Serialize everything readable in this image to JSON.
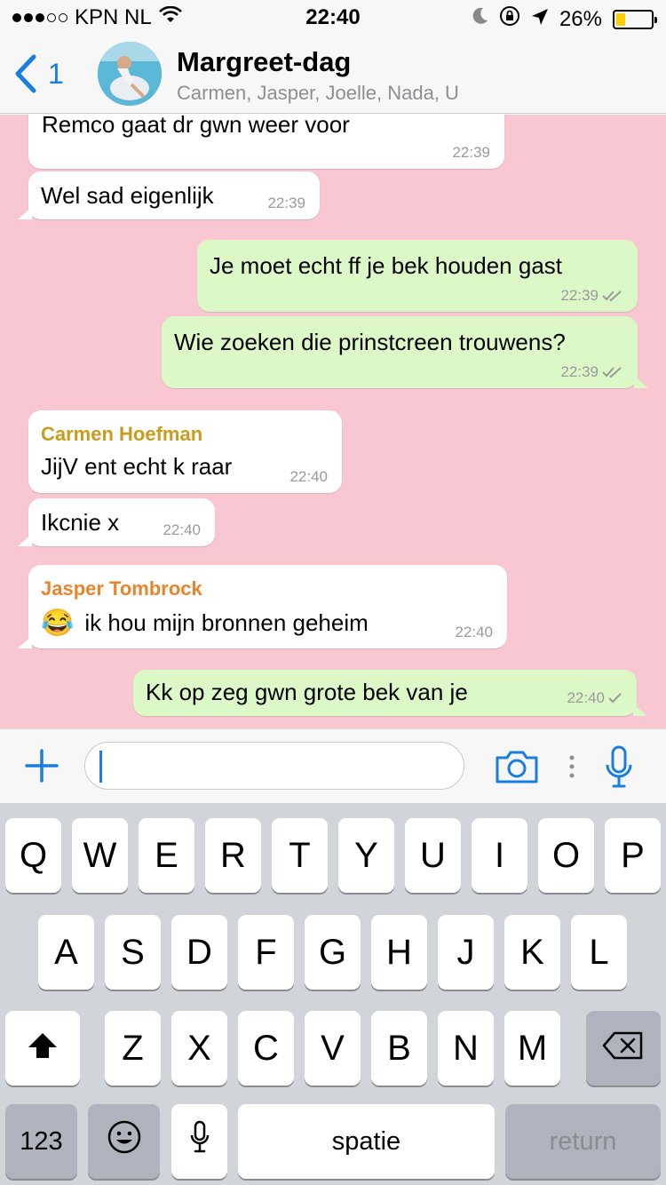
{
  "status_bar": {
    "carrier": "KPN NL",
    "time": "22:40",
    "battery_percent": "26%",
    "battery_level": 0.26,
    "battery_color": "#ffcc00",
    "signal_bars_filled": 3,
    "signal_bars_total": 5
  },
  "header": {
    "back_count": "1",
    "title": "Margreet-dag",
    "subtitle": "Carmen, Jasper, Joelle, Nada, U"
  },
  "messages": [
    {
      "direction": "in",
      "text": "Remco gaat dr gwn weer voor",
      "time": "22:39"
    },
    {
      "direction": "in",
      "text": "Wel sad eigenlijk",
      "time": "22:39"
    },
    {
      "direction": "out",
      "text": "Je moet echt ff je bek houden gast",
      "time": "22:39",
      "status": "read"
    },
    {
      "direction": "out",
      "text": "Wie zoeken die prinstcreen trouwens?",
      "time": "22:39",
      "status": "read"
    },
    {
      "direction": "in",
      "sender": "Carmen Hoefman",
      "sender_color": "#c99c1c",
      "text": "JijV ent echt k raar",
      "time": "22:40"
    },
    {
      "direction": "in",
      "text": "Ikcnie x",
      "time": "22:40"
    },
    {
      "direction": "in",
      "sender": "Jasper Tombrock",
      "sender_color": "#e8842c",
      "emoji": "😂",
      "text": "ik hou mijn bronnen geheim",
      "time": "22:40"
    },
    {
      "direction": "out",
      "text": "Kk op zeg gwn grote bek van je",
      "time": "22:40",
      "status": "sent"
    }
  ],
  "input": {
    "value": ""
  },
  "keyboard": {
    "row1": [
      "Q",
      "W",
      "E",
      "R",
      "T",
      "Y",
      "U",
      "I",
      "O",
      "P"
    ],
    "row2": [
      "A",
      "S",
      "D",
      "F",
      "G",
      "H",
      "J",
      "K",
      "L"
    ],
    "row3": [
      "Z",
      "X",
      "C",
      "V",
      "B",
      "N",
      "M"
    ],
    "numbers_label": "123",
    "space_label": "spatie",
    "return_label": "return"
  },
  "colors": {
    "accent": "#1a7de0",
    "chat_background": "#f8c7d1",
    "outgoing_bubble": "#dcf8c6",
    "incoming_bubble": "#ffffff"
  }
}
